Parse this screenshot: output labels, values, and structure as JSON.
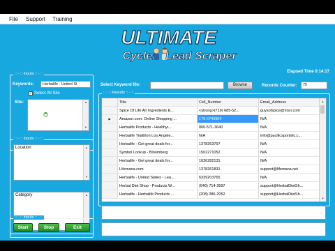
{
  "menu": [
    "File",
    "Support",
    "Training"
  ],
  "logo": {
    "line1": "ULTIMATE",
    "line2_a": "Cycler",
    "line2_b": "Lead Scraper"
  },
  "elapsed": {
    "label": "Elapsed Time",
    "value": "0:14:17"
  },
  "inputs_group": {
    "legend": ":: - :: Inputs :: - ::",
    "keywords_label": "Keywords:",
    "keywords_value": "Herbalife - United St",
    "select_all_label": "Select All Site",
    "select_all_checked": "✓",
    "site_label": "Site:"
  },
  "location_group": {
    "legend": ":: - :: Inputs :: - ::",
    "location_label": "Location",
    "category_label": "Category"
  },
  "buttons_group": {
    "legend": ":: - :: Inputs :: - ::",
    "start": "Start",
    "stop": "Stop",
    "exit": "Exit"
  },
  "keyword_file": {
    "label": "Select Keyword file:",
    "value": "",
    "browse": "Browse"
  },
  "records": {
    "label": "Records Counter:",
    "value": "75"
  },
  "results": {
    "legend": ":: - :: Results :: - ::",
    "columns": [
      "Title",
      "Cell_Number",
      "Email_Address"
    ],
    "rows": [
      [
        "Spice Of Life An Ingredients E...",
        "<strong>(719) 685-52...",
        "guysofspice@msn.com"
      ],
      [
        "Amazon.com: Online Shopping ...",
        "176-6740904",
        "N/A"
      ],
      [
        "Herbalife Products - Healthyi...",
        "800-571-3640",
        "N/A"
      ],
      [
        "Herbalife Triathlon Los Angele...",
        "N/A",
        "info@pacificsportsllc.c..."
      ],
      [
        "Herbalife - Get great deals for...",
        "1378263797",
        "N/A"
      ],
      [
        "Symbol Lookup - Bloomberg",
        "1502271052",
        "N/A"
      ],
      [
        "Herbalife - Get great deals for...",
        "1026282131",
        "N/A"
      ],
      [
        "Lifemana.com",
        "1378261831",
        "support@lifemana.net"
      ],
      [
        "Herbalife - United States - Lea...",
        "6339203765",
        "N/A"
      ],
      [
        "Herbal Diet Shop - Products W...",
        "(646) 714-3597",
        "support@HerbalDietSh..."
      ],
      [
        "Herbalife - Herbalife Products ...",
        "(208) 286-2052",
        "support@HerbalDietSh..."
      ]
    ],
    "selected_row": 1,
    "row_indicator": "▶"
  },
  "colors": {
    "window_bg": "#18a8e0",
    "selection": "#3399ff",
    "button_green": "#2aa02a"
  }
}
